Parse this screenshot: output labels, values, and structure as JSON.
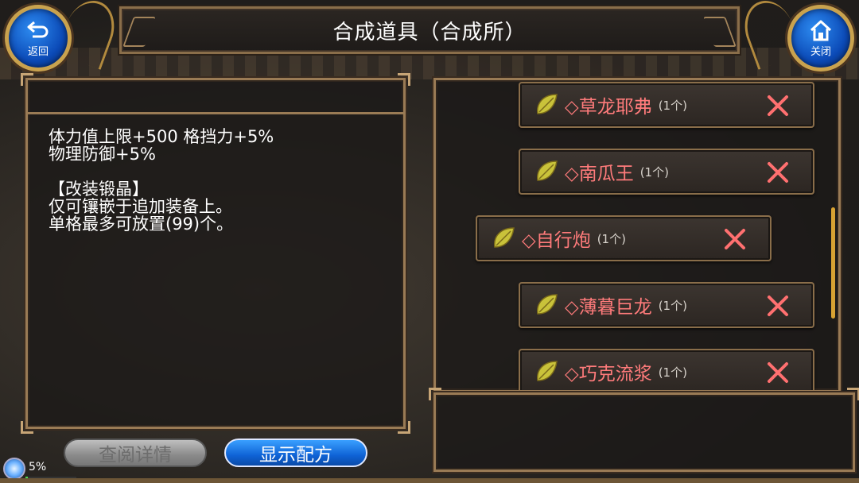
{
  "header": {
    "title": "合成道具（合成所）",
    "back_label": "返回",
    "close_label": "关闭"
  },
  "description": {
    "text": "体力值上限+500 格挡力+5%\n物理防御+5%\n\n【改装锻晶】\n仅可镶嵌于追加装备上。\n单格最多可放置(99)个。"
  },
  "items": [
    {
      "name": "◇草龙耶弗",
      "qty": "(1个)"
    },
    {
      "name": "◇南瓜王",
      "qty": "(1个)"
    },
    {
      "name": "◇自行炮",
      "qty": "(1个)"
    },
    {
      "name": "◇薄暮巨龙",
      "qty": "(1个)"
    },
    {
      "name": "◇巧克流浆",
      "qty": "(1个)"
    }
  ],
  "buttons": {
    "detail_label": "查阅详情",
    "recipe_label": "显示配方"
  },
  "status": {
    "percent_label": "5%",
    "progress": 0.05
  },
  "colors": {
    "item_name": "#ff7b7b",
    "accent_blue": "#0f63d6",
    "frame_gold": "#9a7b55"
  },
  "icons": [
    "return-arrow-icon",
    "home-icon",
    "leaf-icon",
    "close-x-icon"
  ]
}
